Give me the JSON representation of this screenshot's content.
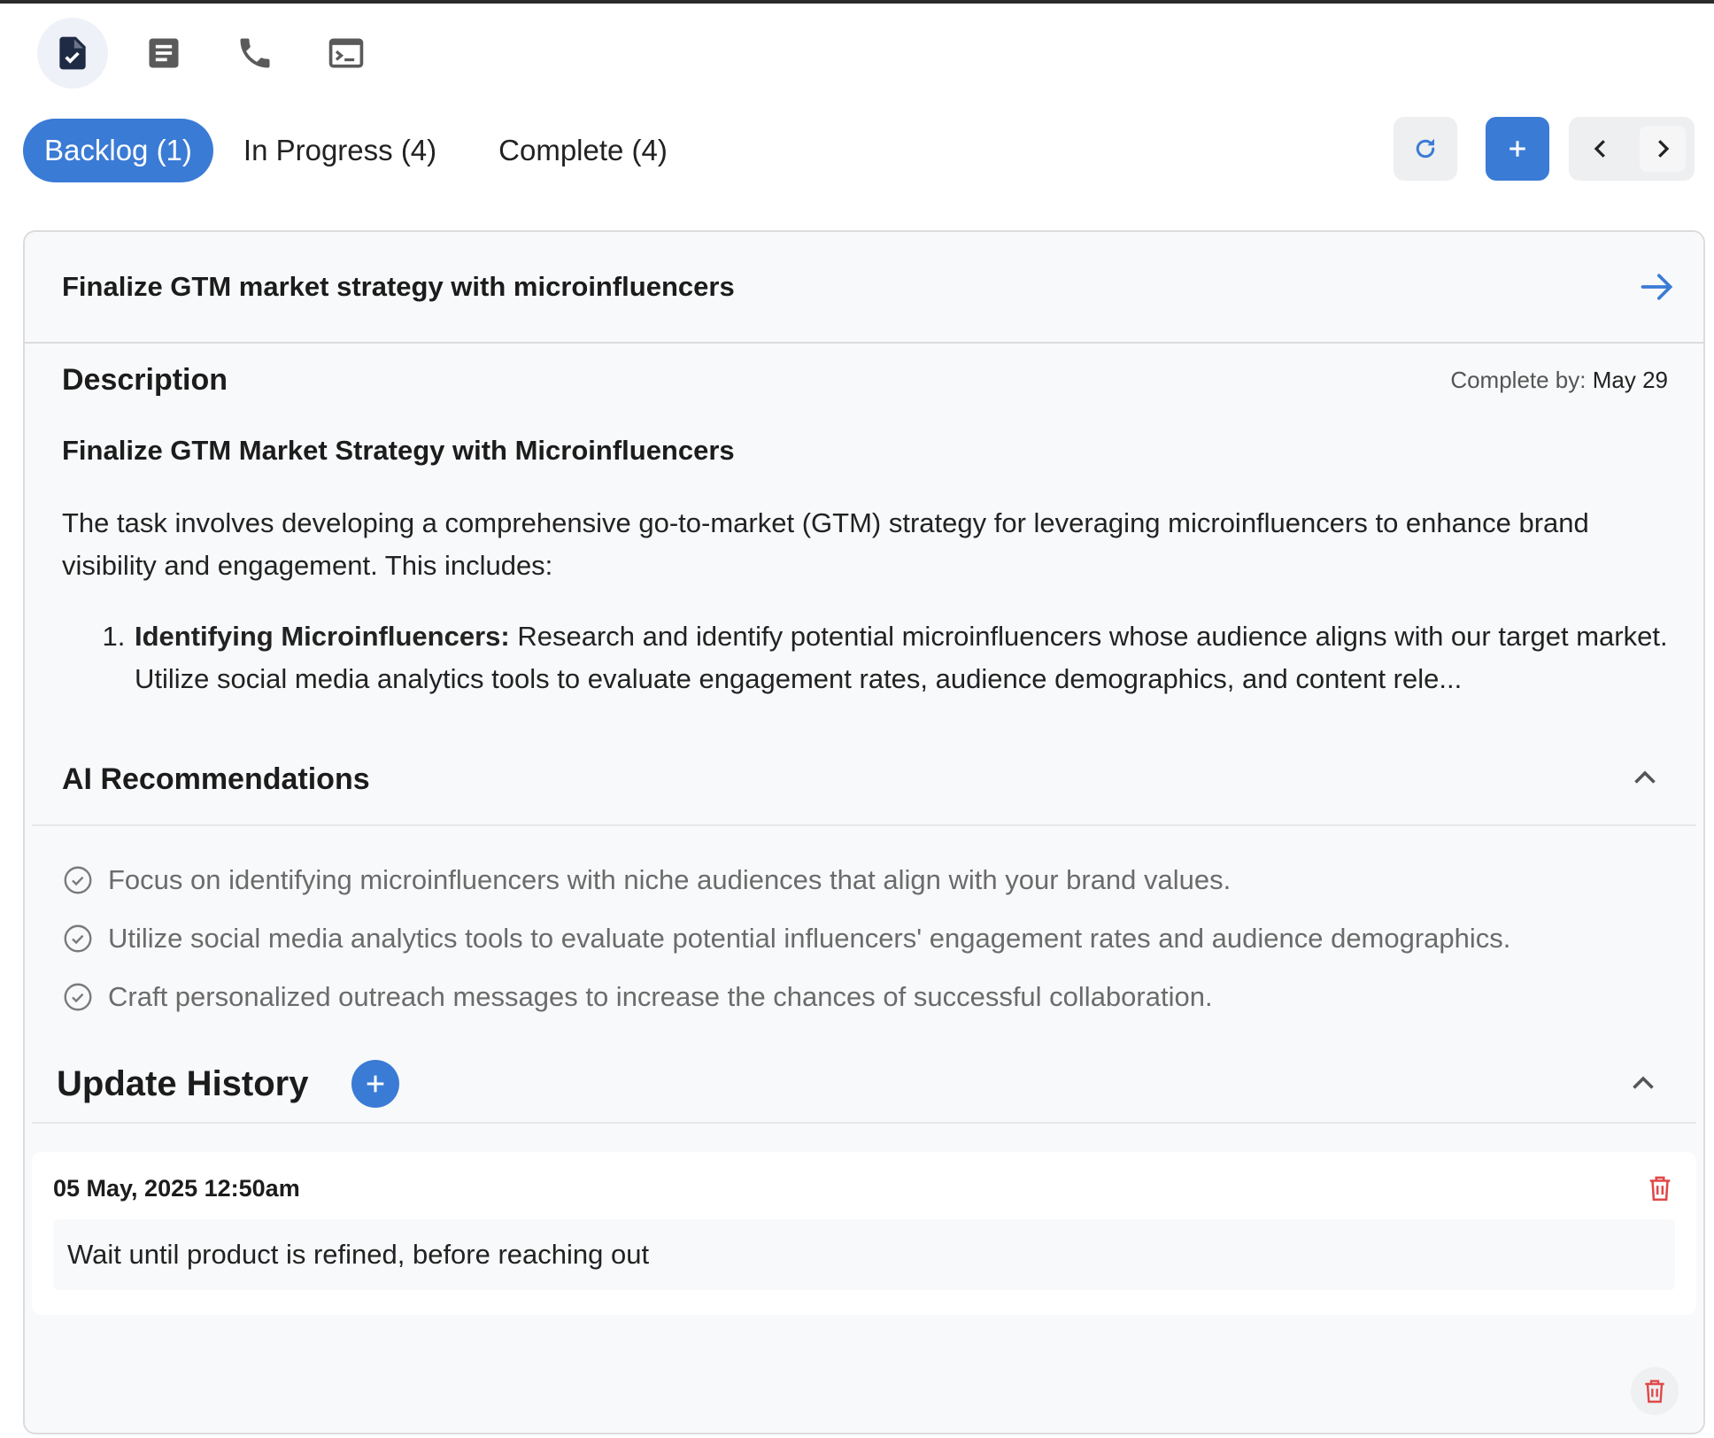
{
  "toolbar": {
    "icons": [
      "task-check-icon",
      "document-icon",
      "phone-icon",
      "terminal-icon"
    ]
  },
  "tabs": [
    {
      "label": "Backlog (1)",
      "active": true
    },
    {
      "label": "In Progress (4)",
      "active": false
    },
    {
      "label": "Complete (4)",
      "active": false
    }
  ],
  "actions": {
    "icons": [
      "refresh-icon",
      "plus-icon",
      "chevron-left-icon",
      "chevron-right-icon"
    ]
  },
  "task": {
    "title": "Finalize GTM market strategy with microinfluencers",
    "description_label": "Description",
    "complete_by_label": "Complete by:",
    "complete_by_value": "May 29",
    "heading": "Finalize GTM Market Strategy with Microinfluencers",
    "paragraph": "The task involves developing a comprehensive go-to-market (GTM) strategy for leveraging microinfluencers to enhance brand visibility and engagement. This includes:",
    "list": [
      {
        "bold": "Identifying Microinfluencers:",
        "text": " Research and identify potential microinfluencers whose audience aligns with our target market. Utilize social media analytics tools to evaluate engagement rates, audience demographics, and content rele..."
      }
    ]
  },
  "ai": {
    "title": "AI Recommendations",
    "items": [
      "Focus on identifying microinfluencers with niche audiences that align with your brand values.",
      "Utilize social media analytics tools to evaluate potential influencers' engagement rates and audience demographics.",
      "Craft personalized outreach messages to increase the chances of successful collaboration."
    ]
  },
  "history": {
    "title": "Update History",
    "entries": [
      {
        "date": "05 May, 2025 12:50am",
        "text": "Wait until product is refined, before reaching out"
      }
    ]
  },
  "colors": {
    "accent": "#3a7bd5",
    "danger": "#e04848",
    "card_bg": "#f8f9fa"
  }
}
